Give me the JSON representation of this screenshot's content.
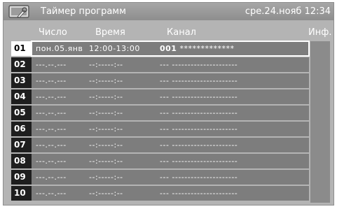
{
  "title": "Таймер программ",
  "clock": "сре.24.нояб 12:34",
  "headers": {
    "date": "Число",
    "time": "Время",
    "channel": "Канал",
    "info": "Инф."
  },
  "rows": [
    {
      "num": "01",
      "date": "пон.05.янв",
      "time": "12:00-13:00",
      "channel_num": "001",
      "channel_name": "*************",
      "selected": true
    },
    {
      "num": "02",
      "date": "---.--.---",
      "time": "--:-----:--",
      "channel": "--- ---------------------",
      "selected": false
    },
    {
      "num": "03",
      "date": "---.--.---",
      "time": "--:-----:--",
      "channel": "--- ---------------------",
      "selected": false
    },
    {
      "num": "04",
      "date": "---.--.---",
      "time": "--:-----:--",
      "channel": "--- ---------------------",
      "selected": false
    },
    {
      "num": "05",
      "date": "---.--.---",
      "time": "--:-----:--",
      "channel": "--- ---------------------",
      "selected": false
    },
    {
      "num": "06",
      "date": "---.--.---",
      "time": "--:-----:--",
      "channel": "--- ---------------------",
      "selected": false
    },
    {
      "num": "07",
      "date": "---.--.---",
      "time": "--:-----:--",
      "channel": "--- ---------------------",
      "selected": false
    },
    {
      "num": "08",
      "date": "---.--.---",
      "time": "--:-----:--",
      "channel": "--- ---------------------",
      "selected": false
    },
    {
      "num": "09",
      "date": "---.--.---",
      "time": "--:-----:--",
      "channel": "--- ---------------------",
      "selected": false
    },
    {
      "num": "10",
      "date": "---.--.---",
      "time": "--:-----:--",
      "channel": "--- ---------------------",
      "selected": false
    }
  ],
  "icons": {
    "title": "timer-tools-icon"
  },
  "colors": {
    "panel": "#b4b4b4",
    "row": "#7d7d7d",
    "number_cell": "#1e1e1e",
    "selected_number_cell": "#ffffff"
  }
}
